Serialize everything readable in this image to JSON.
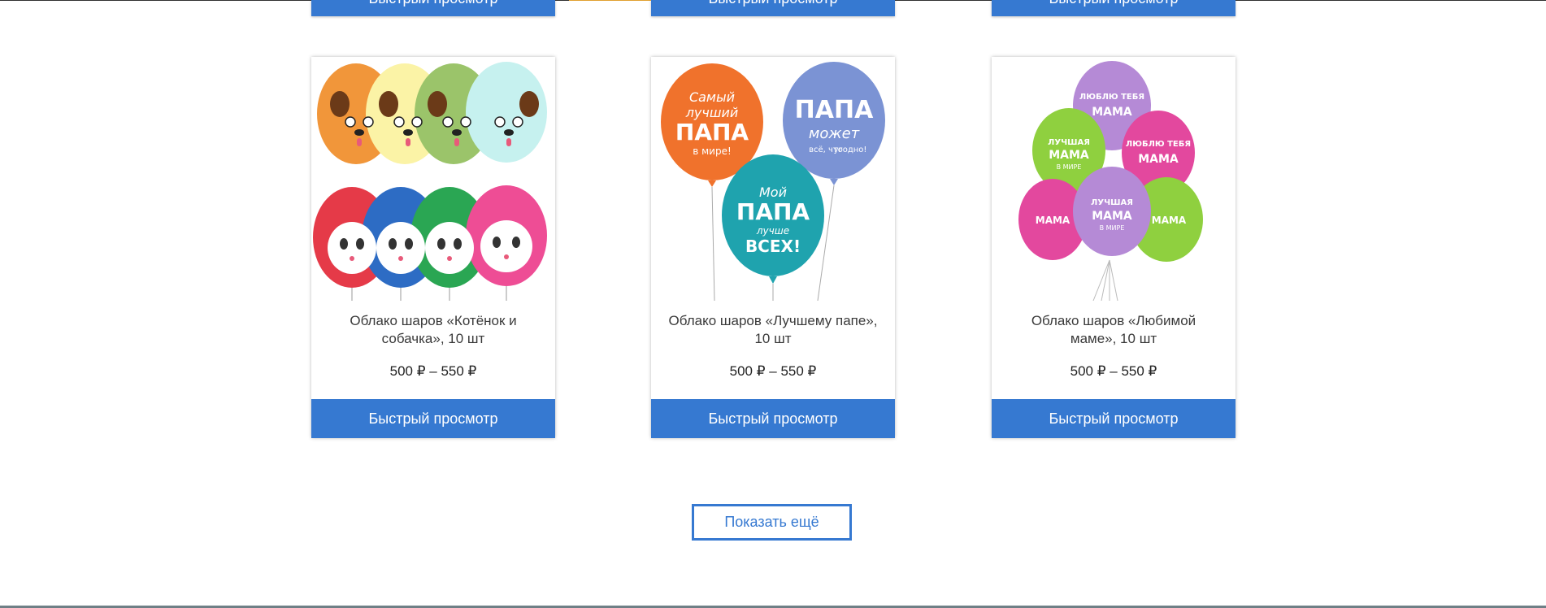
{
  "previous_row": {
    "button_label": "Быстрый просмотр"
  },
  "products": [
    {
      "title": "Облако шаров «Котёнок и собачка», 10 шт",
      "price": "500 ₽ – 550 ₽",
      "button_label": "Быстрый просмотр",
      "image_icon": "balloons-kitten-puppy-image"
    },
    {
      "title": "Облако шаров «Лучшему папе», 10 шт",
      "price": "500 ₽ – 550 ₽",
      "button_label": "Быстрый просмотр",
      "image_icon": "balloons-best-dad-image",
      "balloon_texts": {
        "orange_line1": "Самый",
        "orange_line2": "лучший",
        "orange_line3": "ПАПА",
        "orange_line4": "в мире!",
        "blue_line1": "ПАПА",
        "blue_line2": "может",
        "blue_line3": "всё, что",
        "blue_line4": "угодно!",
        "teal_line1": "Мой",
        "teal_line2": "ПАПА",
        "teal_line3": "лучше",
        "teal_line4": "ВСЕХ!"
      }
    },
    {
      "title": "Облако шаров «Любимой маме», 10 шт",
      "price": "500 ₽ – 550 ₽",
      "button_label": "Быстрый просмотр",
      "image_icon": "balloons-beloved-mom-image",
      "balloon_texts": {
        "love_you": "ЛЮБЛЮ ТЕБЯ",
        "mama": "МАМА",
        "best": "ЛУЧШАЯ",
        "in_world": "В МИРЕ"
      }
    }
  ],
  "show_more_label": "Показать ещё",
  "colors": {
    "accent": "#3679d1",
    "text": "#3a3a3a"
  }
}
